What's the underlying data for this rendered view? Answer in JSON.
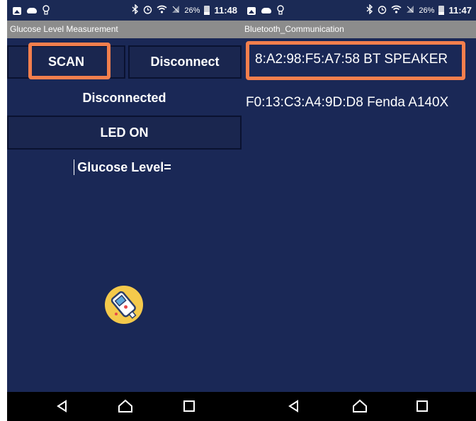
{
  "left_screen": {
    "status": {
      "battery_pct": "26%",
      "time": "11:48"
    },
    "title": "Glucose Level Measurement",
    "scan_button": "SCAN",
    "disconnect_button": "Disconnect",
    "connection_status": "Disconnected",
    "led_button": "LED ON",
    "glucose_label": "Glucose Level="
  },
  "right_screen": {
    "status": {
      "battery_pct": "26%",
      "time": "11:47"
    },
    "title": "Bluetooth_Communication",
    "devices": [
      {
        "label": "8:A2:98:F5:A7:58 BT SPEAKER",
        "selected": true
      },
      {
        "label": "F0:13:C3:A4:9D:D8 Fenda A140X",
        "selected": false
      }
    ]
  },
  "colors": {
    "background": "#1a2856",
    "highlight": "#f47f4d",
    "title_bar": "#8c8c8c",
    "logo": "#f4c94b"
  },
  "icons": [
    "image-icon",
    "cloud-icon",
    "lightbulb-icon",
    "bluetooth-icon",
    "alarm-icon",
    "wifi-icon",
    "no-signal-icon",
    "battery-icon",
    "back-icon",
    "home-icon",
    "recents-icon",
    "glucose-meter-icon"
  ]
}
